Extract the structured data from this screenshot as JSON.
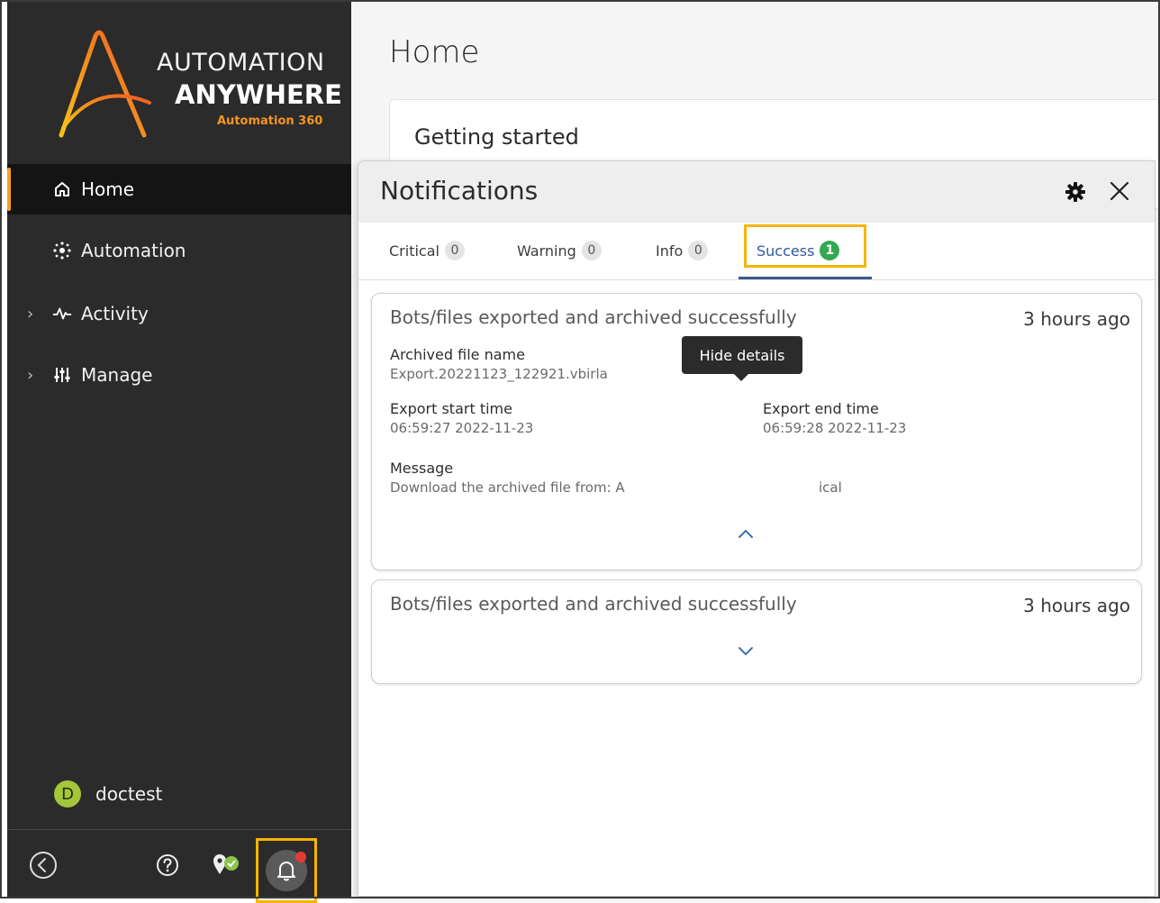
{
  "logo": {
    "line1": "AUTOMATION",
    "line2": "ANYWHERE",
    "line3": "Automation 360"
  },
  "sidebar": {
    "items": [
      {
        "label": "Home",
        "icon": "home-icon",
        "active": true
      },
      {
        "label": "Automation",
        "icon": "automation-icon",
        "active": false
      },
      {
        "label": "Activity",
        "icon": "activity-icon",
        "active": false,
        "expandable": true
      },
      {
        "label": "Manage",
        "icon": "manage-icon",
        "active": false,
        "expandable": true
      }
    ],
    "user": {
      "initial": "D",
      "name": "doctest"
    },
    "bottom_icons": [
      "collapse-icon",
      "help-icon",
      "location-check-icon",
      "bell-icon"
    ]
  },
  "main": {
    "page_title": "Home",
    "card_title": "Getting started"
  },
  "notifications": {
    "title": "Notifications",
    "tabs": [
      {
        "label": "Critical",
        "count": "0"
      },
      {
        "label": "Warning",
        "count": "0"
      },
      {
        "label": "Info",
        "count": "0"
      },
      {
        "label": "Success",
        "count": "1"
      }
    ],
    "selected_tab": "Success",
    "items": [
      {
        "title": "Bots/files exported and archived successfully",
        "time": "3 hours ago",
        "archived_label": "Archived file name",
        "archived_value": "Export.20221123_122921.vbirla",
        "start_label": "Export start time",
        "start_value": "06:59:27 2022-11-23",
        "end_label": "Export end time",
        "end_value": "06:59:28 2022-11-23",
        "message_label": "Message",
        "message_value_a": "Download the archived file from: A",
        "message_value_b": "ical"
      },
      {
        "title": "Bots/files exported and archived successfully",
        "time": "3 hours ago"
      }
    ],
    "tooltip": "Hide details"
  },
  "colors": {
    "sidebar_bg": "#2b2b2b",
    "accent_orange": "#f7a21b",
    "highlight_yellow": "#f7b500",
    "success_green": "#34a853",
    "tab_blue": "#2e5a9c"
  }
}
